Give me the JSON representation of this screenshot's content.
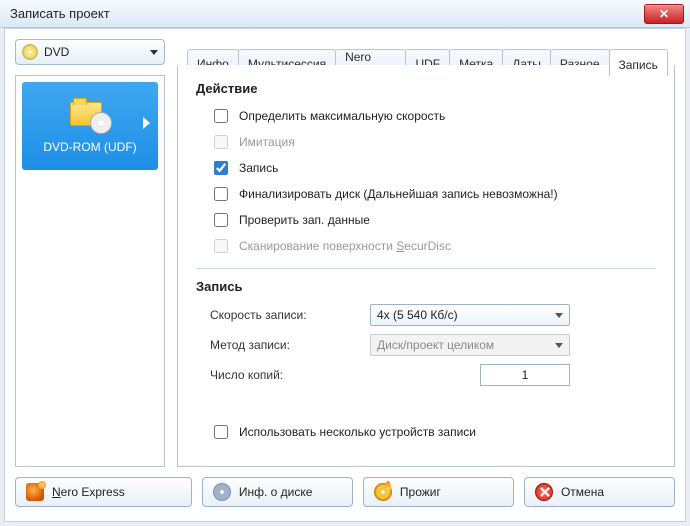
{
  "window": {
    "title": "Записать проект"
  },
  "drive": {
    "label": "DVD"
  },
  "tabs": [
    {
      "label": "Инфо"
    },
    {
      "label": "Мультисессия"
    },
    {
      "label": "Nero DiscSpan"
    },
    {
      "label": "UDF"
    },
    {
      "label": "Метка"
    },
    {
      "label": "Даты"
    },
    {
      "label": "Разное"
    },
    {
      "label": "Запись"
    }
  ],
  "active_tab": 7,
  "sidebar": {
    "items": [
      {
        "label": "DVD-ROM (UDF)"
      }
    ]
  },
  "sections": {
    "action": {
      "title": "Действие",
      "opts": {
        "max_speed": {
          "label": "Определить максимальную скорость",
          "checked": false
        },
        "simulate": {
          "label": "Имитация",
          "checked": false,
          "disabled": true
        },
        "burn": {
          "label": "Запись",
          "checked": true
        },
        "finalize": {
          "label": "Финализировать диск (Дальнейшая запись невозможна!)",
          "checked": false
        },
        "verify": {
          "label": "Проверить зап. данные",
          "checked": false
        },
        "securdisc_pre": {
          "label": "Сканирование поверхности ",
          "disabled": true
        },
        "securdisc_s": {
          "label": "S"
        },
        "securdisc_post": {
          "label": "ecurDisc"
        }
      }
    },
    "burn": {
      "title": "Запись",
      "speed_label": "Скорость записи:",
      "speed_value": "4x (5 540 Кб/с)",
      "method_label": "Метод записи:",
      "method_value": "Диск/проект целиком",
      "copies_label": "Число копий:",
      "copies_value": "1",
      "multi_devices": {
        "label": "Использовать несколько устройств записи",
        "checked": false
      }
    }
  },
  "buttons": {
    "nero_express_n": "N",
    "nero_express_rest": "ero Express",
    "disc_info": "Инф. о диске",
    "burn": "Прожиг",
    "cancel": "Отмена"
  }
}
